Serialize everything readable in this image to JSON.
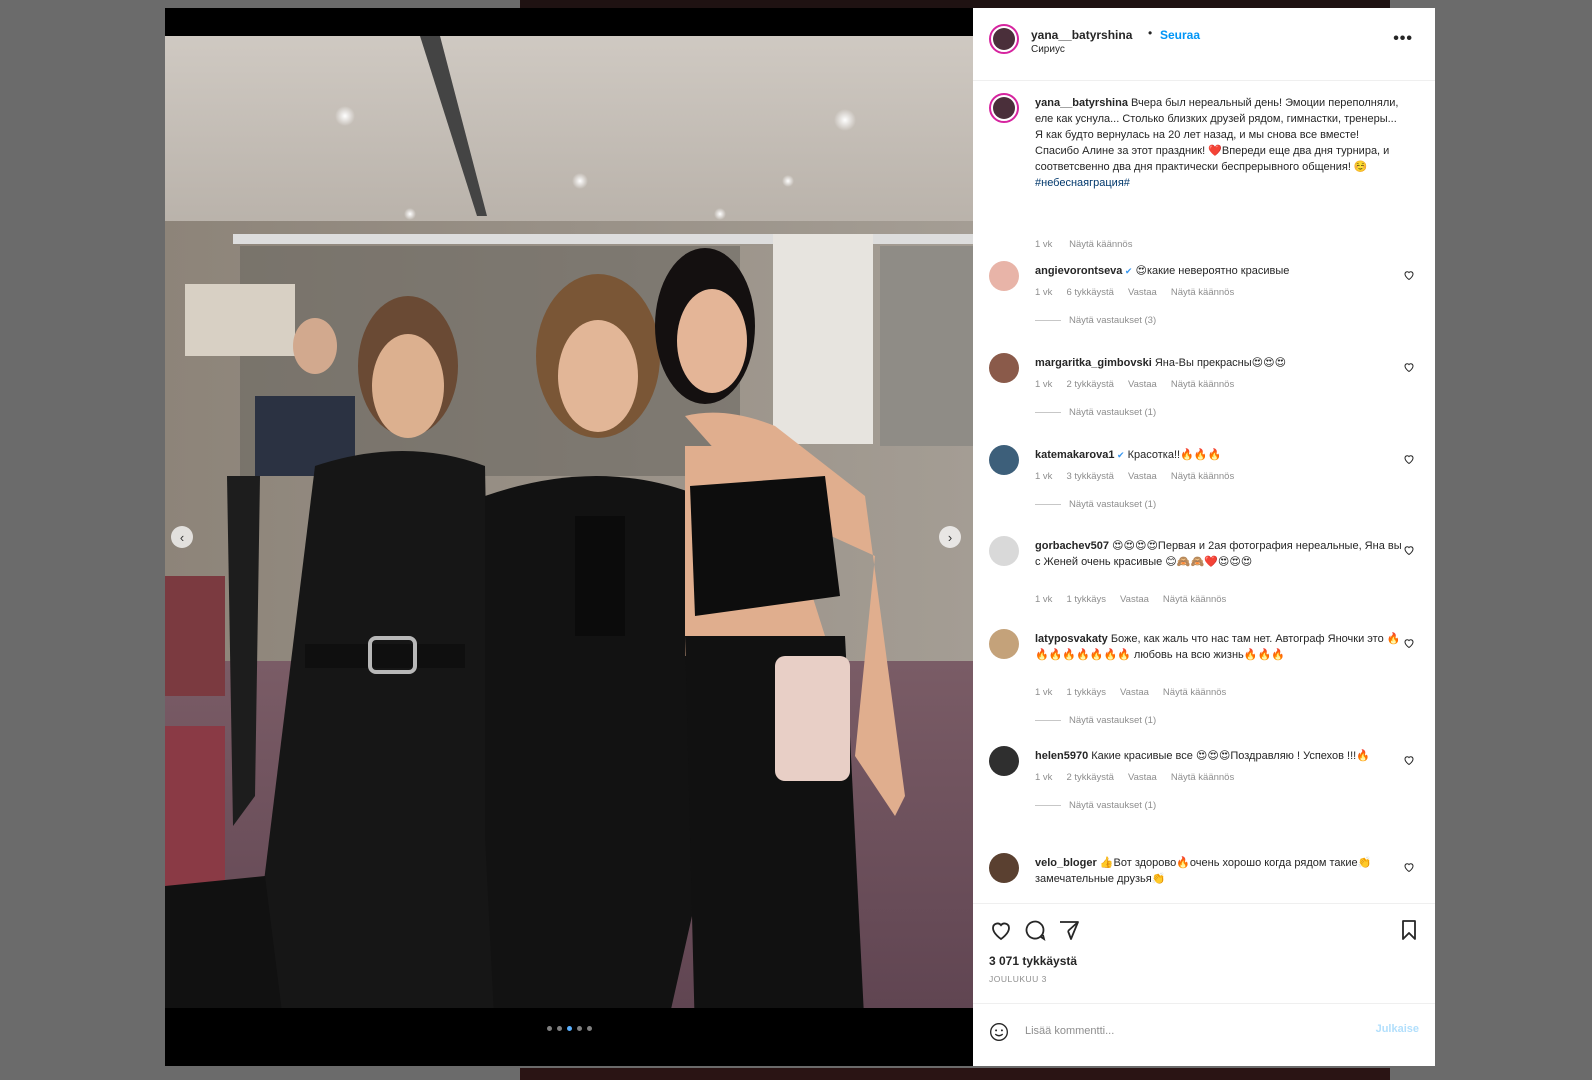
{
  "post": {
    "username": "yana__batyrshina",
    "follow_label": "Seuraa",
    "separator": "•",
    "location": "Сириус",
    "more_label": "•••",
    "caption": {
      "username": "yana__batyrshina",
      "text": "Вчера был нереальный день! Эмоции переполняли, еле как уснула... Столько близких друзей рядом, гимнастки, тренеры... Я как будто вернулась на 20 лет назад, и мы снова все вместе! Спасибо Алине за этот праздник! ❤️Впереди еще два дня турнира, и соответсвенно два дня практически беспрерывного общения! ☺️",
      "hashtag": "#небеснаяграция#",
      "time": "1 vk",
      "translate": "Näytä käännös"
    },
    "comments": [
      {
        "username": "angievorontseva",
        "verified": true,
        "text": "😍какие невероятно красивые",
        "time": "1 vk",
        "likes": "6 tykkäystä",
        "reply": "Vastaa",
        "translate": "Näytä käännös",
        "view_replies": "Näytä vastaukset (3)"
      },
      {
        "username": "margaritka_gimbovski",
        "verified": false,
        "text": "Яна-Вы прекрасны😍😍😍",
        "time": "1 vk",
        "likes": "2 tykkäystä",
        "reply": "Vastaa",
        "translate": "Näytä käännös",
        "view_replies": "Näytä vastaukset (1)"
      },
      {
        "username": "katemakarova1",
        "verified": true,
        "text": "Красотка!!🔥🔥🔥",
        "time": "1 vk",
        "likes": "3 tykkäystä",
        "reply": "Vastaa",
        "translate": "Näytä käännös",
        "view_replies": "Näytä vastaukset (1)"
      },
      {
        "username": "gorbachev507",
        "verified": false,
        "text": "😍😍😍😍Первая и 2ая фотография нереальные, Яна вы с Женей очень красивые 😊🙈🙈❤️😍😍😍",
        "time": "1 vk",
        "likes": "1 tykkäys",
        "reply": "Vastaa",
        "translate": "Näytä käännös",
        "view_replies": ""
      },
      {
        "username": "latyposvakaty",
        "verified": false,
        "text": "Боже, как жаль что нас там нет. Автограф Яночки это 🔥🔥🔥🔥🔥🔥🔥🔥 любовь на всю жизнь🔥🔥🔥",
        "time": "1 vk",
        "likes": "1 tykkäys",
        "reply": "Vastaa",
        "translate": "Näytä käännös",
        "view_replies": "Näytä vastaukset (1)"
      },
      {
        "username": "helen5970",
        "verified": false,
        "text": "Какие красивые все 😍😍😍Поздравляю ! Успехов !!!🔥",
        "time": "1 vk",
        "likes": "2 tykkäystä",
        "reply": "Vastaa",
        "translate": "Näytä käännös",
        "view_replies": "Näytä vastaukset (1)"
      },
      {
        "username": "velo_bloger",
        "verified": false,
        "text": "👍Вот здорово🔥очень хорошо когда рядом такие👏 замечательные друзья👏",
        "time": "",
        "likes": "",
        "reply": "",
        "translate": "",
        "view_replies": ""
      }
    ],
    "likes_count": "3 071 tykkäystä",
    "date": "JOULUKUU 3",
    "add_comment_placeholder": "Lisää kommentti...",
    "post_label": "Julkaise",
    "carousel": {
      "count": 5,
      "active": 3
    },
    "colors": {
      "accent": "#0095f6",
      "heart": "#ed4956",
      "story_ring": "#d6249f"
    }
  }
}
